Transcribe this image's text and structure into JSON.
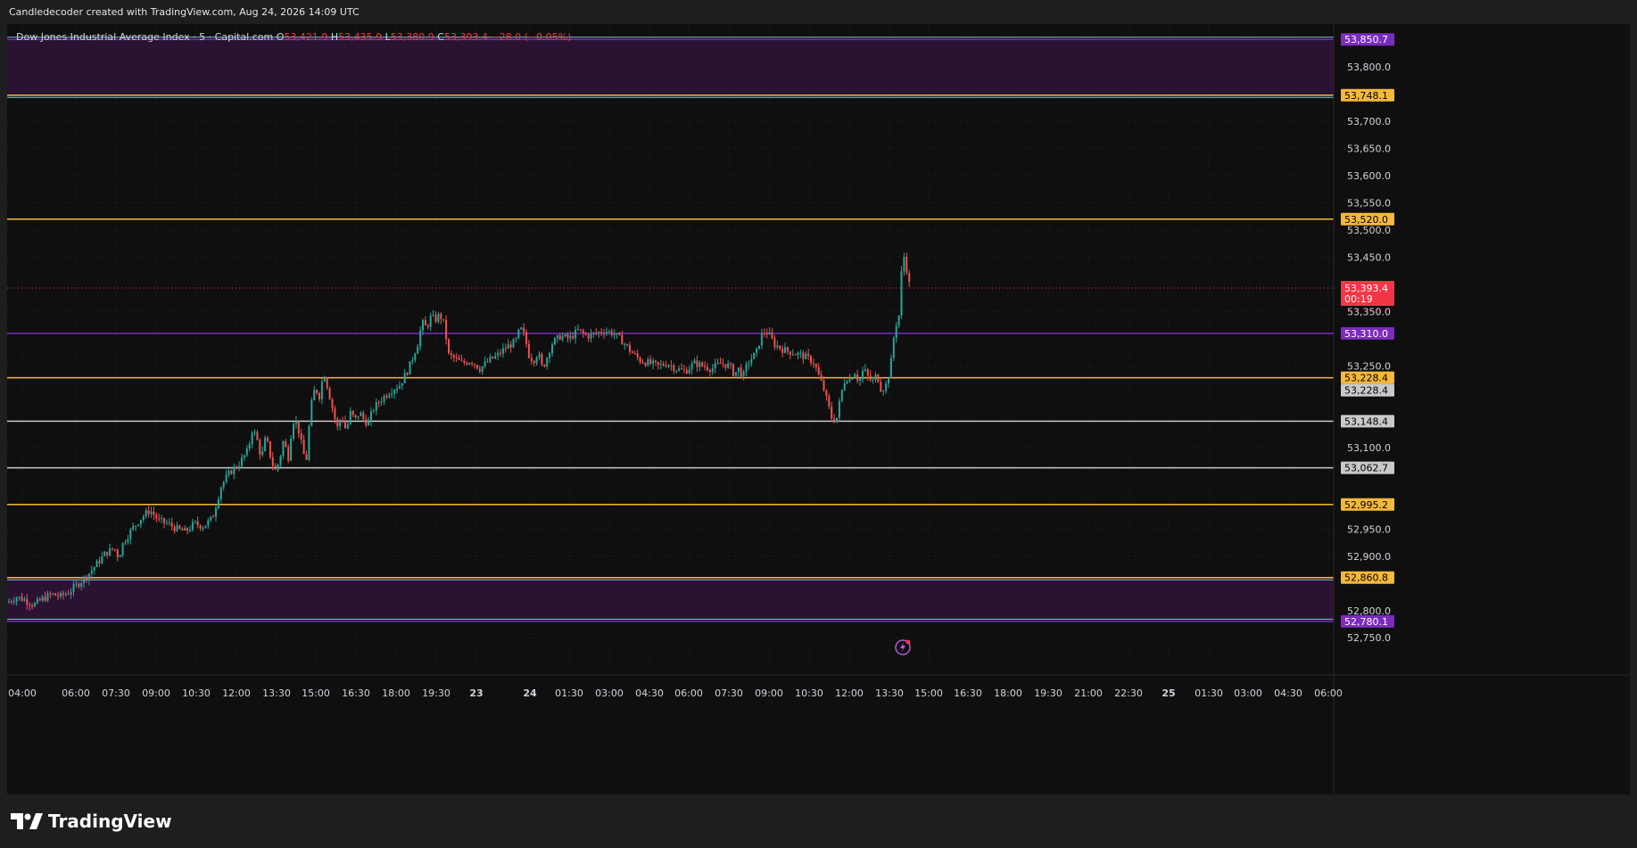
{
  "header": {
    "attribution": "Candledecoder created with TradingView.com, Aug 24, 2026 14:09 UTC"
  },
  "legend": {
    "symbol": "Dow Jones Industrial Average Index · 5 · Capital.com",
    "open_label": "O",
    "open": "53,421.9",
    "high_label": "H",
    "high": "53,435.9",
    "low_label": "L",
    "low": "53,380.9",
    "close_label": "C",
    "close": "53,393.4",
    "change": "−28.0 (−0.05%)"
  },
  "brand": {
    "name": "TradingView"
  },
  "colors": {
    "background": "#0f0f0f",
    "up": "#26a69a",
    "down": "#ef5350",
    "zone": "#2a1232",
    "orange_level": "#f5b93a",
    "purple_level": "#7b2cbf",
    "white_level": "#c9c9c9",
    "cyan_level": "#7ec8e3",
    "price_tag": "#f23645"
  },
  "chart_data": {
    "type": "candlestick",
    "symbol": "Dow Jones Industrial Average Index",
    "interval": "5",
    "y_ticks": [
      53800,
      53700,
      53650,
      53600,
      53550,
      53500,
      53450,
      53350,
      53250,
      53100,
      52950,
      52900,
      52800,
      52750
    ],
    "y_tick_labels": [
      "53,800.0",
      "53,700.0",
      "53,650.0",
      "53,600.0",
      "53,550.0",
      "53,500.0",
      "53,450.0",
      "53,350.0",
      "53,250.0",
      "53,100.0",
      "52,950.0",
      "52,900.0",
      "52,800.0",
      "52,750.0"
    ],
    "x_labels": [
      "04:00",
      "06:00",
      "07:30",
      "09:00",
      "10:30",
      "12:00",
      "13:30",
      "15:00",
      "16:30",
      "18:00",
      "19:30",
      "23",
      "24",
      "01:30",
      "03:00",
      "04:30",
      "06:00",
      "07:30",
      "09:00",
      "10:30",
      "12:00",
      "13:30",
      "15:00",
      "16:30",
      "18:00",
      "19:30",
      "21:00",
      "22:30",
      "25",
      "01:30",
      "03:00",
      "04:30",
      "06:00"
    ],
    "levels": [
      {
        "value": 53850.7,
        "label": "53,850.7",
        "color": "purple"
      },
      {
        "value": 53748.1,
        "label": "53,748.1",
        "color": "orange"
      },
      {
        "value": 53520.0,
        "label": "53,520.0",
        "color": "orange"
      },
      {
        "value": 53310.0,
        "label": "53,310.0",
        "color": "purple"
      },
      {
        "value": 53228.4,
        "label": "53,228.4",
        "color": "orange"
      },
      {
        "value": 53228.4,
        "label": "53,228.4",
        "color": "gray"
      },
      {
        "value": 53148.4,
        "label": "53,148.4",
        "color": "gray"
      },
      {
        "value": 53062.7,
        "label": "53,062.7",
        "color": "gray"
      },
      {
        "value": 52995.2,
        "label": "52,995.2",
        "color": "orange"
      },
      {
        "value": 52860.8,
        "label": "52,860.8",
        "color": "orange"
      },
      {
        "value": 52780.1,
        "label": "52,780.1",
        "color": "purple"
      }
    ],
    "zones": [
      {
        "from": 53748.1,
        "to": 53850.7
      },
      {
        "from": 52780.1,
        "to": 52860.8
      }
    ],
    "last_price": {
      "value": 53393.4,
      "label": "53,393.4",
      "countdown": "00:19"
    },
    "close_path": [
      [
        0,
        52815
      ],
      [
        10,
        52825
      ],
      [
        20,
        52820
      ],
      [
        30,
        52810
      ],
      [
        40,
        52822
      ],
      [
        50,
        52830
      ],
      [
        60,
        52826
      ],
      [
        70,
        52835
      ],
      [
        80,
        52850
      ],
      [
        90,
        52865
      ],
      [
        100,
        52885
      ],
      [
        110,
        52905
      ],
      [
        120,
        52915
      ],
      [
        125,
        52898
      ],
      [
        130,
        52925
      ],
      [
        140,
        52950
      ],
      [
        150,
        52970
      ],
      [
        160,
        52985
      ],
      [
        170,
        52965
      ],
      [
        180,
        52960
      ],
      [
        190,
        52950
      ],
      [
        200,
        52945
      ],
      [
        210,
        52960
      ],
      [
        220,
        52955
      ],
      [
        230,
        52970
      ],
      [
        240,
        53030
      ],
      [
        250,
        53055
      ],
      [
        260,
        53070
      ],
      [
        270,
        53095
      ],
      [
        275,
        53135
      ],
      [
        280,
        53115
      ],
      [
        285,
        53080
      ],
      [
        290,
        53120
      ],
      [
        295,
        53085
      ],
      [
        300,
        53055
      ],
      [
        305,
        53075
      ],
      [
        310,
        53115
      ],
      [
        315,
        53080
      ],
      [
        320,
        53150
      ],
      [
        325,
        53145
      ],
      [
        330,
        53105
      ],
      [
        335,
        53070
      ],
      [
        340,
        53170
      ],
      [
        345,
        53210
      ],
      [
        350,
        53195
      ],
      [
        355,
        53240
      ],
      [
        360,
        53205
      ],
      [
        365,
        53170
      ],
      [
        370,
        53135
      ],
      [
        375,
        53160
      ],
      [
        380,
        53130
      ],
      [
        385,
        53165
      ],
      [
        390,
        53150
      ],
      [
        395,
        53165
      ],
      [
        400,
        53150
      ],
      [
        405,
        53145
      ],
      [
        410,
        53170
      ],
      [
        420,
        53190
      ],
      [
        430,
        53205
      ],
      [
        440,
        53215
      ],
      [
        450,
        53245
      ],
      [
        460,
        53290
      ],
      [
        465,
        53330
      ],
      [
        470,
        53320
      ],
      [
        475,
        53340
      ],
      [
        480,
        53335
      ],
      [
        485,
        53345
      ],
      [
        490,
        53325
      ],
      [
        495,
        53270
      ],
      [
        500,
        53265
      ],
      [
        510,
        53255
      ],
      [
        520,
        53260
      ],
      [
        530,
        53245
      ],
      [
        540,
        53260
      ],
      [
        550,
        53270
      ],
      [
        560,
        53285
      ],
      [
        570,
        53295
      ],
      [
        575,
        53320
      ],
      [
        580,
        53305
      ],
      [
        585,
        53270
      ],
      [
        590,
        53260
      ],
      [
        595,
        53275
      ],
      [
        600,
        53245
      ],
      [
        605,
        53265
      ],
      [
        610,
        53290
      ],
      [
        620,
        53305
      ],
      [
        630,
        53300
      ],
      [
        640,
        53315
      ],
      [
        650,
        53305
      ],
      [
        660,
        53310
      ],
      [
        670,
        53315
      ],
      [
        680,
        53310
      ],
      [
        690,
        53295
      ],
      [
        700,
        53275
      ],
      [
        710,
        53260
      ],
      [
        720,
        53255
      ],
      [
        730,
        53250
      ],
      [
        740,
        53255
      ],
      [
        750,
        53245
      ],
      [
        760,
        53240
      ],
      [
        770,
        53255
      ],
      [
        780,
        53250
      ],
      [
        790,
        53245
      ],
      [
        800,
        53255
      ],
      [
        810,
        53250
      ],
      [
        815,
        53235
      ],
      [
        820,
        53245
      ],
      [
        825,
        53230
      ],
      [
        830,
        53255
      ],
      [
        840,
        53275
      ],
      [
        845,
        53305
      ],
      [
        850,
        53315
      ],
      [
        855,
        53305
      ],
      [
        860,
        53290
      ],
      [
        870,
        53280
      ],
      [
        880,
        53275
      ],
      [
        890,
        53270
      ],
      [
        900,
        53262
      ],
      [
        905,
        53255
      ],
      [
        910,
        53230
      ],
      [
        915,
        53210
      ],
      [
        920,
        53180
      ],
      [
        925,
        53150
      ],
      [
        930,
        53155
      ],
      [
        935,
        53200
      ],
      [
        940,
        53230
      ],
      [
        945,
        53225
      ],
      [
        950,
        53240
      ],
      [
        955,
        53220
      ],
      [
        960,
        53245
      ],
      [
        965,
        53230
      ],
      [
        970,
        53220
      ],
      [
        975,
        53235
      ],
      [
        980,
        53205
      ],
      [
        985,
        53215
      ],
      [
        990,
        53245
      ],
      [
        995,
        53320
      ],
      [
        1000,
        53345
      ],
      [
        1003,
        53435
      ],
      [
        1006,
        53455
      ],
      [
        1009,
        53420
      ],
      [
        1012,
        53393
      ]
    ]
  }
}
